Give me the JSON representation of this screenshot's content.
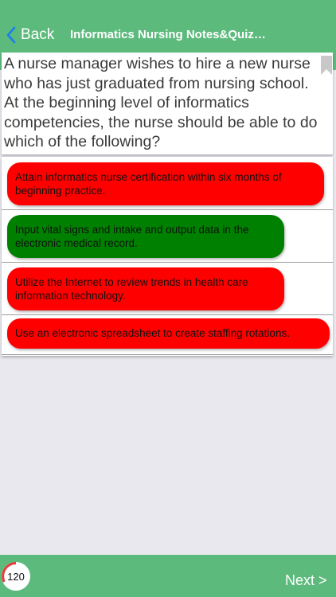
{
  "header": {
    "back_label": "Back",
    "title": "Informatics Nursing Notes&Quizze...",
    "color": "#5dba7d"
  },
  "question": {
    "text": "A nurse manager wishes to hire a new nurse who has just graduated from nursing school. At the beginning level of informatics competencies, the nurse should be able to do which of the following?",
    "bookmark_icon": "bookmark-icon"
  },
  "answers": [
    {
      "text": "Attain informatics nurse certification within six months of beginning practice.",
      "state": "incorrect",
      "color": "#ff0000"
    },
    {
      "text": "Input vital signs and intake and output data in the electronic medical record.",
      "state": "correct",
      "color": "#008000"
    },
    {
      "text": "Utilize the Internet to review trends in health care information technology.",
      "state": "incorrect",
      "color": "#ff0000"
    },
    {
      "text": "Use an electronic spreadsheet to create staffing rotations.",
      "state": "incorrect",
      "color": "#ff0000"
    }
  ],
  "footer": {
    "counter": "120",
    "next_label": "Next >",
    "counter_ring_color": "#e83a3a"
  }
}
